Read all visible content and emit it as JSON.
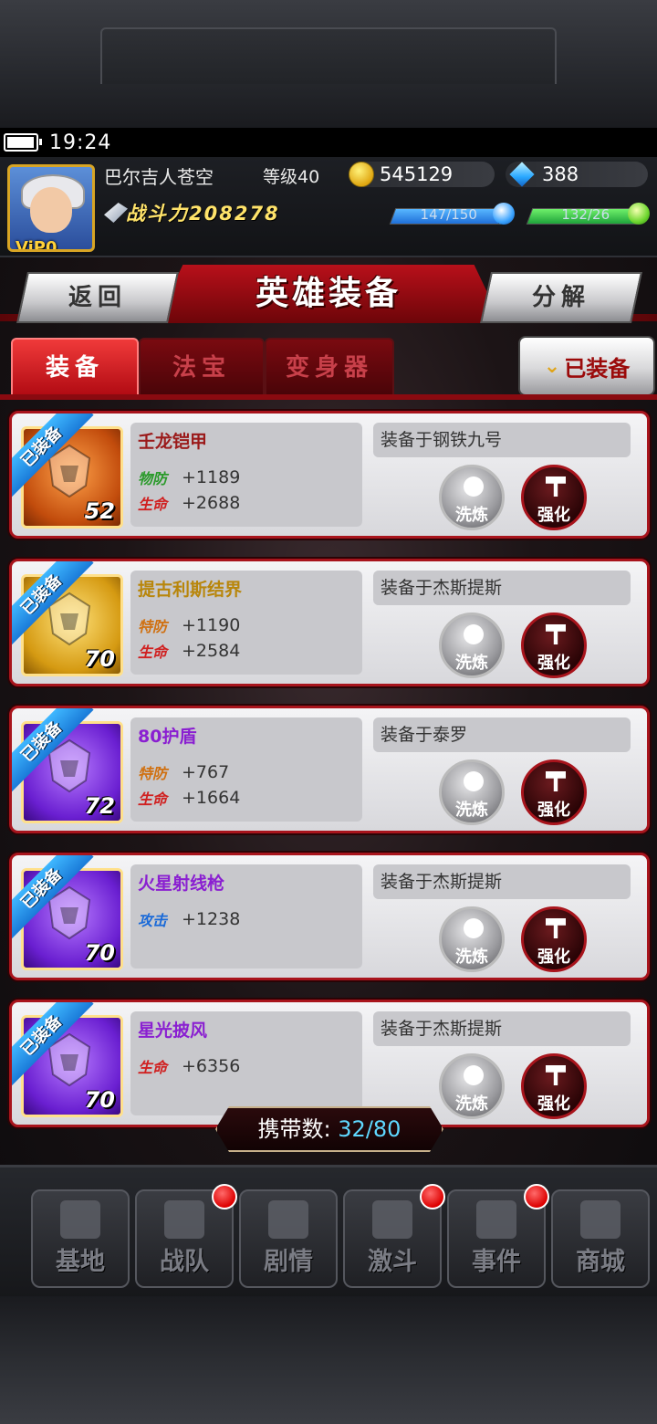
{
  "status_bar": {
    "time": "19:24",
    "battery_level": 0.95
  },
  "player": {
    "name": "巴尔吉人苍空",
    "level": "等级40",
    "vip": "ViP0",
    "gold": "545129",
    "gems": "388",
    "power_label": "战斗力",
    "power_value": "208278",
    "energy": {
      "text": "147/150",
      "fraction": 0.98
    },
    "stamina": {
      "text": "132/26",
      "fraction": 1.0
    }
  },
  "header": {
    "title": "英雄装备",
    "back_label": "返回",
    "split_label": "分解"
  },
  "tabs": [
    {
      "label": "装备",
      "active": true
    },
    {
      "label": "法宝",
      "active": false
    },
    {
      "label": "变身器",
      "active": false
    }
  ],
  "equipped_filter_label": "已装备",
  "items": [
    {
      "badge": "已装备",
      "name": "壬龙铠甲",
      "name_color": "#9b1a1a",
      "level": "52",
      "icon_style": "orange",
      "stats": [
        {
          "tag": "物防",
          "tag_color": "#2a9a2a",
          "value": "+1189"
        },
        {
          "tag": "生命",
          "tag_color": "#d02020",
          "value": "+2688"
        }
      ],
      "equipped_to": "装备于钢铁九号",
      "refine_label": "洗炼",
      "strengthen_label": "强化"
    },
    {
      "badge": "已装备",
      "name": "提古利斯结界",
      "name_color": "#b8860b",
      "level": "70",
      "icon_style": "gold",
      "stats": [
        {
          "tag": "特防",
          "tag_color": "#d07010",
          "value": "+1190"
        },
        {
          "tag": "生命",
          "tag_color": "#d02020",
          "value": "+2584"
        }
      ],
      "equipped_to": "装备于杰斯提斯",
      "refine_label": "洗炼",
      "strengthen_label": "强化"
    },
    {
      "badge": "已装备",
      "name": "80护盾",
      "name_color": "#8a1fd1",
      "level": "72",
      "icon_style": "purple",
      "stats": [
        {
          "tag": "特防",
          "tag_color": "#d07010",
          "value": "+767"
        },
        {
          "tag": "生命",
          "tag_color": "#d02020",
          "value": "+1664"
        }
      ],
      "equipped_to": "装备于泰罗",
      "refine_label": "洗炼",
      "strengthen_label": "强化"
    },
    {
      "badge": "已装备",
      "name": "火星射线枪",
      "name_color": "#8a1fd1",
      "level": "70",
      "icon_style": "purple",
      "stats": [
        {
          "tag": "攻击",
          "tag_color": "#1a6ad8",
          "value": "+1238"
        }
      ],
      "equipped_to": "装备于杰斯提斯",
      "refine_label": "洗炼",
      "strengthen_label": "强化"
    },
    {
      "badge": "已装备",
      "name": "星光披风",
      "name_color": "#8a1fd1",
      "level": "70",
      "icon_style": "purple",
      "stats": [
        {
          "tag": "生命",
          "tag_color": "#d02020",
          "value": "+6356"
        }
      ],
      "equipped_to": "装备于杰斯提斯",
      "refine_label": "洗炼",
      "strengthen_label": "强化"
    }
  ],
  "carry": {
    "label": "携带数:",
    "value": "32/80"
  },
  "nav": [
    {
      "label": "基地",
      "icon": "base-icon",
      "badge": false
    },
    {
      "label": "战队",
      "icon": "team-icon",
      "badge": true
    },
    {
      "label": "剧情",
      "icon": "story-icon",
      "badge": false
    },
    {
      "label": "激斗",
      "icon": "battle-icon",
      "badge": true
    },
    {
      "label": "事件",
      "icon": "event-icon",
      "badge": true
    },
    {
      "label": "商城",
      "icon": "shop-cart-icon",
      "badge": false
    }
  ]
}
